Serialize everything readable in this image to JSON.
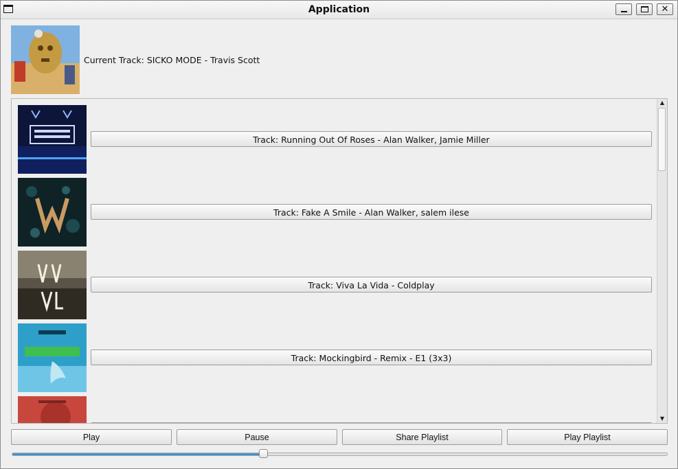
{
  "window": {
    "title": "Application"
  },
  "now_playing": {
    "label": "Current Track: SICKO MODE - Travis Scott"
  },
  "tracks": [
    {
      "label": "Track: Running Out Of Roses - Alan Walker, Jamie Miller"
    },
    {
      "label": "Track: Fake A Smile - Alan Walker, salem ilese"
    },
    {
      "label": "Track: Viva La Vida - Coldplay"
    },
    {
      "label": "Track: Mockingbird - Remix - E1 (3x3)"
    },
    {
      "label": ""
    }
  ],
  "controls": {
    "play": "Play",
    "pause": "Pause",
    "share": "Share Playlist",
    "play_playlist": "Play Playlist"
  },
  "progress": {
    "value": 0.383
  },
  "colors": {
    "accent": "#3a8fd6"
  }
}
